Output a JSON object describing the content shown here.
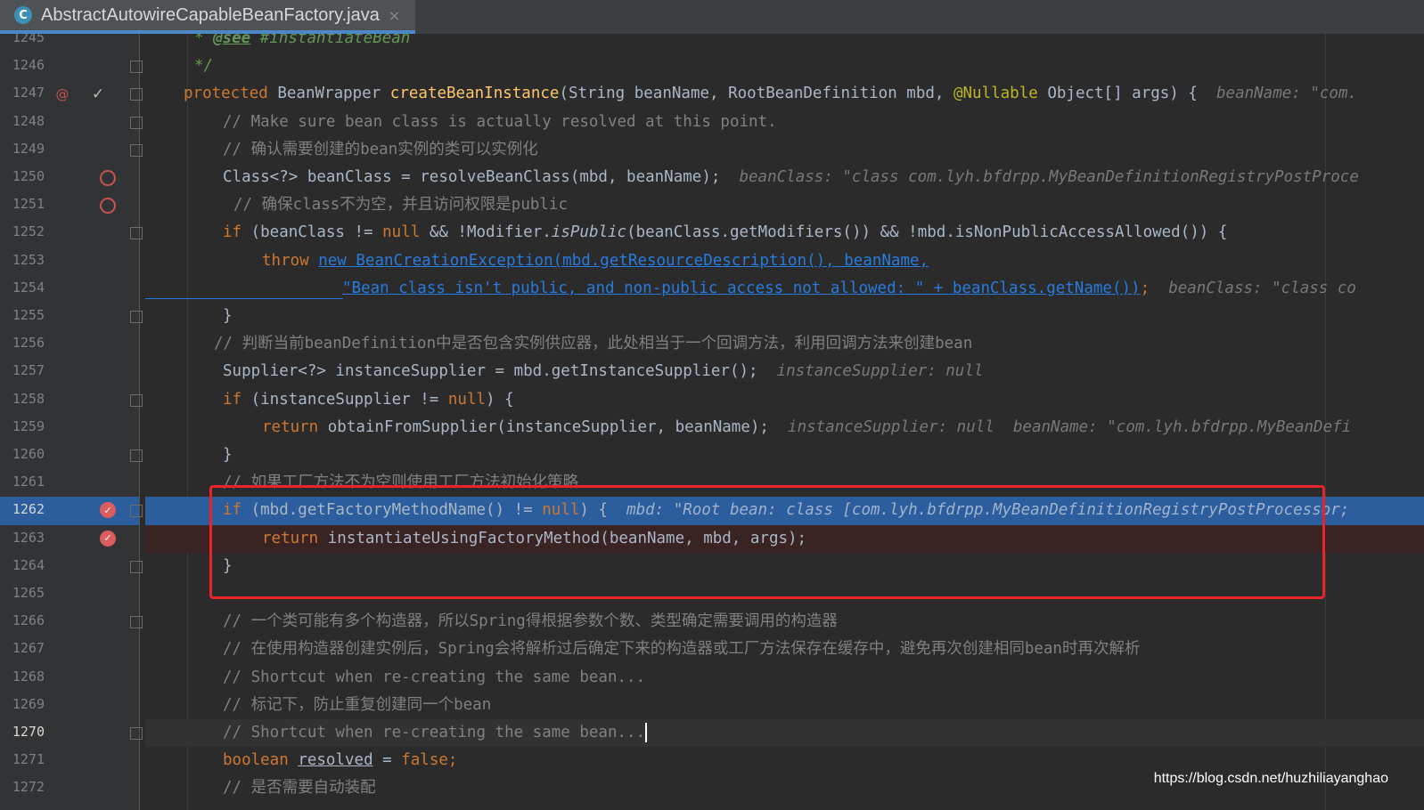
{
  "tab": {
    "icon_letter": "C",
    "title": "AbstractAutowireCapableBeanFactory.java",
    "close_glyph": "×"
  },
  "watermark": "https://blog.csdn.net/huzhiliayanghao",
  "lines": {
    "l1245": {
      "num": "1245",
      "star": "* ",
      "tag": "@see",
      "rest": " #instantiateBean"
    },
    "l1246": {
      "num": "1246",
      "text": "*/"
    },
    "l1247": {
      "num": "1247",
      "kw": "protected",
      "t1": " BeanWrapper ",
      "fn": "createBeanInstance",
      "t2": "(String beanName, RootBeanDefinition mbd, ",
      "ann": "@Nullable",
      "t3": " Object[] args) {",
      "hint": "beanName: \"com."
    },
    "l1248": {
      "num": "1248",
      "text": "// Make sure bean class is actually resolved at this point."
    },
    "l1249": {
      "num": "1249",
      "text": "// 确认需要创建的bean实例的类可以实例化"
    },
    "l1250": {
      "num": "1250",
      "t1": "Class<?> beanClass = resolveBeanClass(mbd, beanName);",
      "hint": "beanClass: \"class com.lyh.bfdrpp.MyBeanDefinitionRegistryPostProce"
    },
    "l1251": {
      "num": "1251",
      "text": "// 确保class不为空，并且访问权限是public"
    },
    "l1252": {
      "num": "1252",
      "kw": "if",
      "t1": " (beanClass != ",
      "kw2": "null",
      "t2": " && !Modifier.",
      "it": "isPublic",
      "t3": "(beanClass.getModifiers()) && !mbd.isNonPublicAccessAllowed()) {"
    },
    "l1253": {
      "num": "1253",
      "kw": "throw",
      "link": "new BeanCreationException(mbd.getResourceDescription(), beanName,"
    },
    "l1254": {
      "num": "1254",
      "link": "\"Bean class isn't public, and non-public access not allowed: \" + beanClass.getName())",
      "semi": ";",
      "hint": "beanClass: \"class co"
    },
    "l1255": {
      "num": "1255",
      "text": "}"
    },
    "l1256": {
      "num": "1256",
      "text": "// 判断当前beanDefinition中是否包含实例供应器，此处相当于一个回调方法，利用回调方法来创建bean"
    },
    "l1257": {
      "num": "1257",
      "t1": "Supplier<?> instanceSupplier = mbd.getInstanceSupplier();",
      "hint": "instanceSupplier: null"
    },
    "l1258": {
      "num": "1258",
      "kw": "if",
      "t1": " (instanceSupplier != ",
      "kw2": "null",
      "t2": ") {"
    },
    "l1259": {
      "num": "1259",
      "kw": "return",
      "t1": " obtainFromSupplier(instanceSupplier, beanName);",
      "hint": "instanceSupplier: null  beanName: \"com.lyh.bfdrpp.MyBeanDefi"
    },
    "l1260": {
      "num": "1260",
      "text": "}"
    },
    "l1261": {
      "num": "1261",
      "text": "// 如果工厂方法不为空则使用工厂方法初始化策略"
    },
    "l1262": {
      "num": "1262",
      "kw": "if",
      "t1": " (mbd.getFactoryMethodName() != ",
      "kw2": "null",
      "t2": ") {",
      "hint": "mbd: \"Root bean: class [com.lyh.bfdrpp.MyBeanDefinitionRegistryPostProcessor;"
    },
    "l1263": {
      "num": "1263",
      "kw": "return",
      "t1": " instantiateUsingFactoryMethod(beanName, mbd, args);"
    },
    "l1264": {
      "num": "1264",
      "text": "}"
    },
    "l1265": {
      "num": "1265"
    },
    "l1266": {
      "num": "1266",
      "text": "// 一个类可能有多个构造器，所以Spring得根据参数个数、类型确定需要调用的构造器"
    },
    "l1267": {
      "num": "1267",
      "text": "// 在使用构造器创建实例后，Spring会将解析过后确定下来的构造器或工厂方法保存在缓存中，避免再次创建相同bean时再次解析"
    },
    "l1268": {
      "num": "1268",
      "text": "// Shortcut when re-creating the same bean..."
    },
    "l1269": {
      "num": "1269",
      "text": "// 标记下，防止重复创建同一个bean"
    },
    "l1270": {
      "num": "1270",
      "text": "// Shortcut when re-creating the same bean..."
    },
    "l1271": {
      "num": "1271",
      "kw": "boolean",
      "ul": "resolved",
      "t1": " = ",
      "kw2": "false",
      "t2": ";"
    },
    "l1272": {
      "num": "1272",
      "text": "// 是否需要自动装配"
    }
  },
  "colors": {
    "editor_bg": "#2b2b2b",
    "keyword": "#cc7832",
    "comment": "#808080",
    "method": "#ffc66d",
    "selection": "#2c5d9c",
    "highlight_box": "#e8232a"
  }
}
